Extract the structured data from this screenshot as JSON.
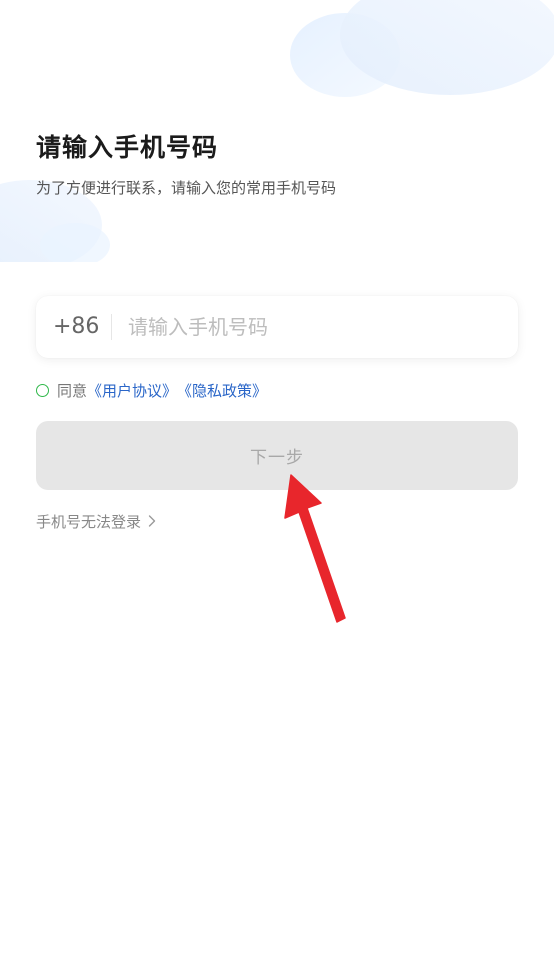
{
  "page": {
    "title": "请输入手机号码",
    "subtitle": "为了方便进行联系，请输入您的常用手机号码"
  },
  "phone": {
    "country_code": "+86",
    "placeholder": "请输入手机号码",
    "value": ""
  },
  "agreement": {
    "checked": false,
    "prefix": "同意",
    "user_agreement": "《用户协议》",
    "privacy_policy": "《隐私政策》"
  },
  "next_button": {
    "label": "下一步",
    "enabled": false
  },
  "cannot_login": {
    "label": "手机号无法登录"
  },
  "icons": {
    "checkbox": "radio-circle-icon",
    "chevron": "chevron-right-icon",
    "annotation": "red-arrow-icon"
  },
  "colors": {
    "accent_green": "#2fb84a",
    "link_blue": "#2a66c8",
    "button_disabled": "#e6e6e6",
    "annotation_red": "#e8262c"
  }
}
